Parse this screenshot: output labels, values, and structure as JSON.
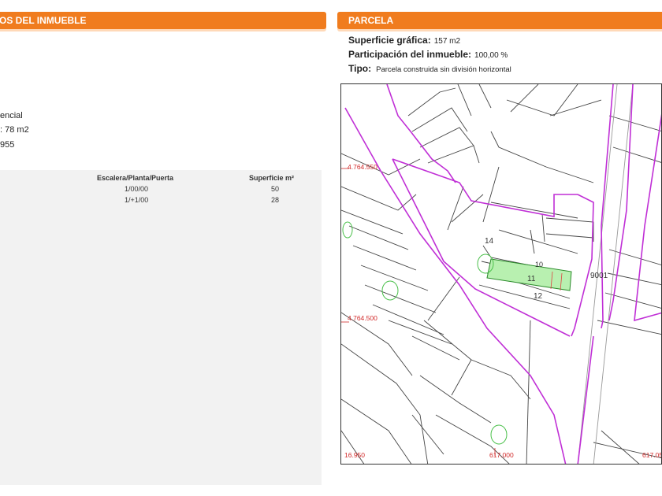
{
  "left_panel": {
    "header": "OS DEL INMUEBLE",
    "fragments": {
      "uso": "encial",
      "superficie": ": 78 m2",
      "anio": "955"
    },
    "table": {
      "headers": {
        "escalera": "Escalera/Planta/Puerta",
        "superficie": "Superficie m²"
      },
      "rows": [
        {
          "escalera": "1/00/00",
          "superficie": "50"
        },
        {
          "escalera": "1/+1/00",
          "superficie": "28"
        }
      ]
    }
  },
  "right_panel": {
    "header": "PARCELA",
    "superficie_label": "Superficie gráfica:",
    "superficie_value": "157 m2",
    "participacion_label": "Participación del inmueble:",
    "participacion_value": "100,00 %",
    "tipo_label": "Tipo:",
    "tipo_value": "Parcela construida sin división horizontal"
  },
  "map": {
    "coord_labels": {
      "n1": "4.764.550",
      "n2": "4.764.500",
      "e1": "16.950",
      "e2": "617.000",
      "e3": "617.05"
    },
    "parcel_labels": {
      "p14": "14",
      "p11": "11",
      "p12": "12",
      "p10": "10",
      "p9001": "9001"
    },
    "colors": {
      "boundary": "#c02fd6",
      "highlight": "#b8f0b0",
      "coords": "#d12a2a",
      "lines": "#333333"
    }
  }
}
